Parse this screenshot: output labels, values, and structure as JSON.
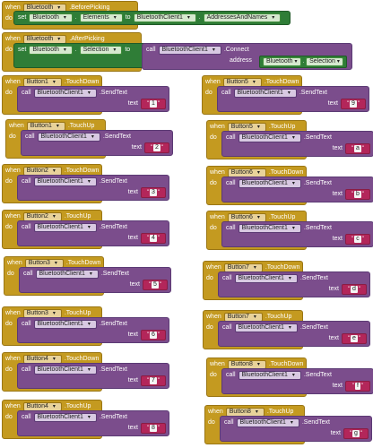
{
  "labels": {
    "when": "when",
    "do": "do",
    "call": "call",
    "set": "set",
    "to": "to",
    "text": "text",
    "address": "address",
    "quote": "\""
  },
  "before": {
    "component": "Bluetooth",
    "event": ".BeforePicking",
    "target": "Bluetooth",
    "property": "Elements",
    "src_component": "BluetoothClient1",
    "src_property": "AddressesAndNames"
  },
  "after": {
    "component": "Bluetooth",
    "event": ".AfterPicking",
    "target": "Bluetooth",
    "property": "Selection",
    "client": "BluetoothClient1",
    "method": ".Connect",
    "addr_component": "Bluetooth",
    "addr_property": "Selection"
  },
  "handlers": [
    {
      "button": "Button1",
      "event": ".TouchDown",
      "client": "BluetoothClient1",
      "method": ".SendText",
      "value": "1"
    },
    {
      "button": "Button1",
      "event": ".TouchUp",
      "client": "BluetoothClient1",
      "method": ".SendText",
      "value": "2"
    },
    {
      "button": "Button2",
      "event": ".TouchDown",
      "client": "BluetoothClient1",
      "method": ".SendText",
      "value": "3"
    },
    {
      "button": "Button2",
      "event": ".TouchUp",
      "client": "BluetoothClient1",
      "method": ".SendText",
      "value": "4"
    },
    {
      "button": "Button3",
      "event": ".TouchDown",
      "client": "BluetoothClient1",
      "method": ".SendText",
      "value": "5"
    },
    {
      "button": "Button3",
      "event": ".TouchUp",
      "client": "BluetoothClient1",
      "method": ".SendText",
      "value": "6"
    },
    {
      "button": "Button4",
      "event": ".TouchDown",
      "client": "BluetoothClient1",
      "method": ".SendText",
      "value": "7"
    },
    {
      "button": "Button4",
      "event": ".TouchUp",
      "client": "BluetoothClient1",
      "method": ".SendText",
      "value": "8"
    },
    {
      "button": "Button5",
      "event": ".TouchDown",
      "client": "BluetoothClient1",
      "method": ".SendText",
      "value": "9"
    },
    {
      "button": "Button5",
      "event": ".TouchUp",
      "client": "BluetoothClient1",
      "method": ".SendText",
      "value": "a"
    },
    {
      "button": "Button6",
      "event": ".TouchDown",
      "client": "BluetoothClient1",
      "method": ".SendText",
      "value": "b"
    },
    {
      "button": "Button6",
      "event": ".TouchUp",
      "client": "BluetoothClient1",
      "method": ".SendText",
      "value": "c"
    },
    {
      "button": "Button7",
      "event": ".TouchDown",
      "client": "BluetoothClient1",
      "method": ".SendText",
      "value": "d"
    },
    {
      "button": "Button7",
      "event": ".TouchUp",
      "client": "BluetoothClient1",
      "method": ".SendText",
      "value": "e"
    },
    {
      "button": "Button8",
      "event": ".TouchDown",
      "client": "BluetoothClient1",
      "method": ".SendText",
      "value": "f"
    },
    {
      "button": "Button8",
      "event": ".TouchUp",
      "client": "BluetoothClient1",
      "method": ".SendText",
      "value": "g"
    }
  ]
}
